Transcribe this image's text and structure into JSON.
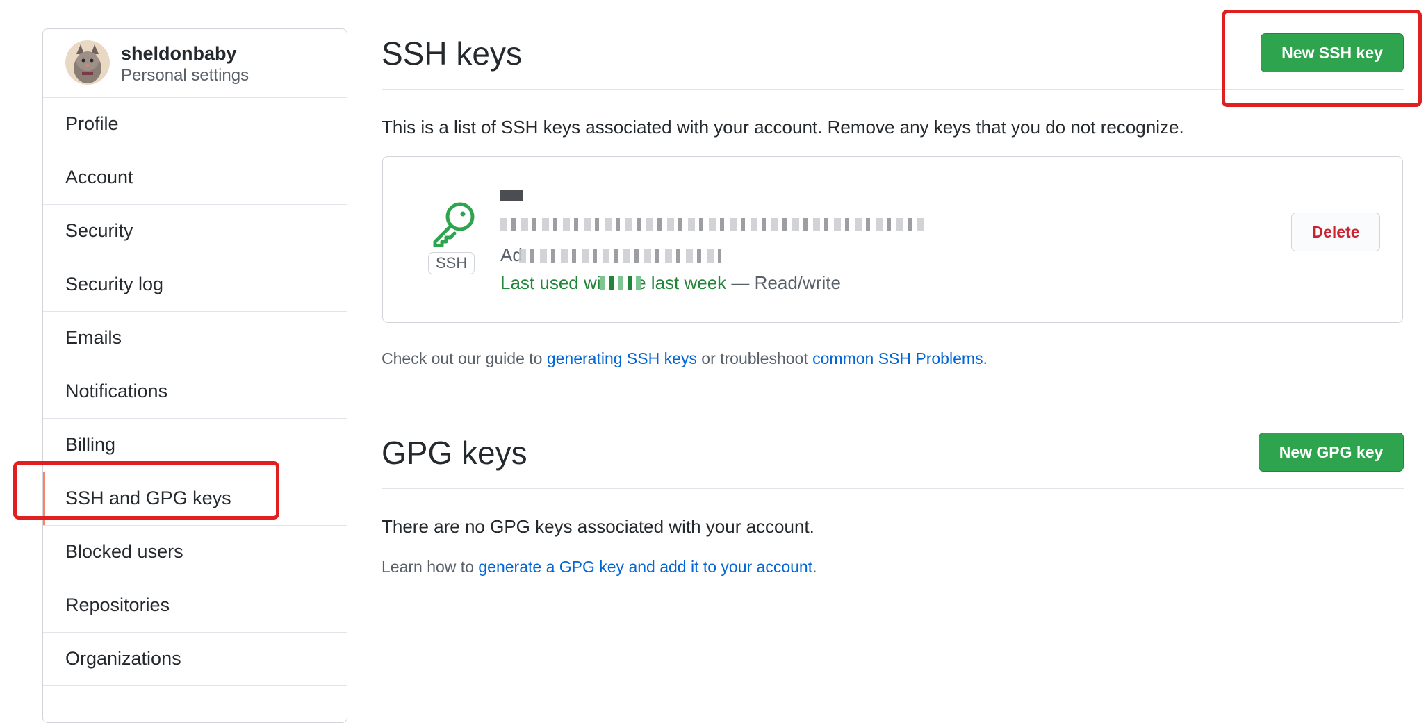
{
  "user": {
    "username": "sheldonbaby",
    "subtitle": "Personal settings"
  },
  "sidebar": {
    "items": [
      {
        "label": "Profile"
      },
      {
        "label": "Account"
      },
      {
        "label": "Security"
      },
      {
        "label": "Security log"
      },
      {
        "label": "Emails"
      },
      {
        "label": "Notifications"
      },
      {
        "label": "Billing"
      },
      {
        "label": "SSH and GPG keys",
        "selected": true
      },
      {
        "label": "Blocked users"
      },
      {
        "label": "Repositories"
      },
      {
        "label": "Organizations"
      }
    ]
  },
  "ssh": {
    "title": "SSH keys",
    "new_button": "New SSH key",
    "description": "This is a list of SSH keys associated with your account. Remove any keys that you do not recognize.",
    "key": {
      "badge": "SSH",
      "added_prefix": "Ad",
      "last_used": "Last used with the last week",
      "access": " — Read/write",
      "delete_label": "Delete"
    },
    "guide": {
      "prefix": "Check out our guide to ",
      "link1": "generating SSH keys",
      "middle": " or troubleshoot ",
      "link2": "common SSH Problems",
      "suffix": "."
    }
  },
  "gpg": {
    "title": "GPG keys",
    "new_button": "New GPG key",
    "empty": "There are no GPG keys associated with your account.",
    "learn": {
      "prefix": "Learn how to ",
      "link": "generate a GPG key and add it to your account",
      "suffix": "."
    }
  },
  "colors": {
    "primary_green": "#2ea44f",
    "link_blue": "#0366d6",
    "danger_red": "#cb2431",
    "annotation_red": "#e02020",
    "selected_marker": "#f9826c"
  }
}
